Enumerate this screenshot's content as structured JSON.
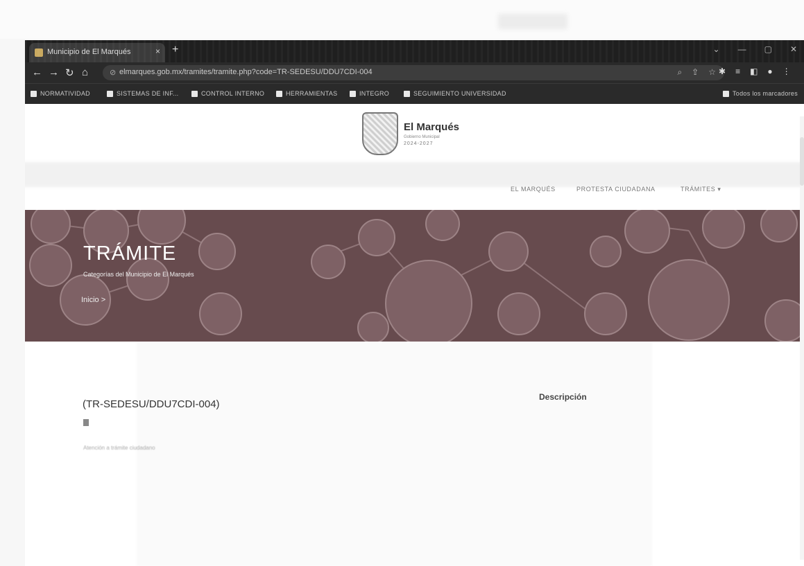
{
  "browser": {
    "tab_title": "Municipio de El Marqués",
    "tab_close": "×",
    "new_tab": "+",
    "url": "elmarques.gob.mx/tramites/tramite.php?code=TR-SEDESU/DDU7CDI-004",
    "bookmarks": [
      {
        "label": "NORMATIVIDAD"
      },
      {
        "label": "SISTEMAS DE INF..."
      },
      {
        "label": "CONTROL INTERNO"
      },
      {
        "label": "HERRAMIENTAS"
      },
      {
        "label": "INTEGRO"
      },
      {
        "label": "SEGUIMIENTO UNIVERSIDAD"
      }
    ],
    "all_bookmarks_label": "Todos los marcadores"
  },
  "site": {
    "logo_name": "El Marqués",
    "logo_subtitle": "Gobierno Municipal",
    "logo_years": "2024-2027",
    "nav": [
      "EL MARQUÉS",
      "PROTESTA CIUDADANA",
      "TRÁMITES ▾"
    ]
  },
  "hero": {
    "title": "TRÁMITE",
    "subtitle": "Categorías del Municipio de El Marqués",
    "breadcrumb": "Inicio  >"
  },
  "content": {
    "code": "(TR-SEDESU/DDU7CDI-004)",
    "faint_text": "Atención a trámite ciudadano",
    "description_label": "Descripción"
  }
}
